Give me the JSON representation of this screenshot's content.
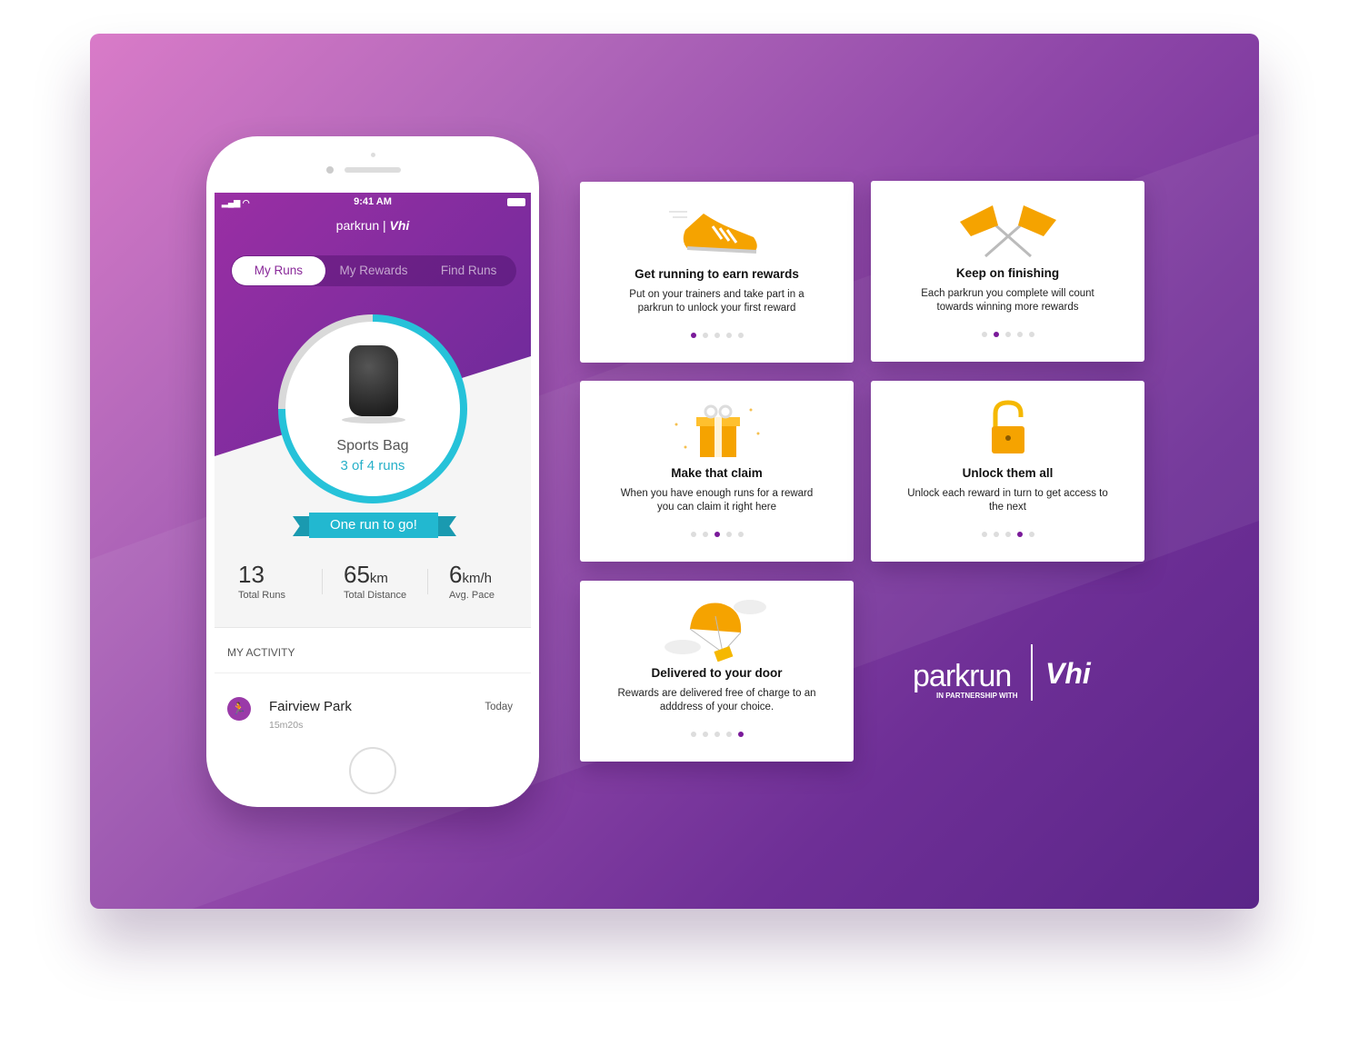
{
  "phone": {
    "status": {
      "time": "9:41 AM"
    },
    "logo": {
      "brand": "parkrun",
      "partner": "Vhi"
    },
    "tabs": [
      {
        "label": "My Runs"
      },
      {
        "label": "My Rewards"
      },
      {
        "label": "Find Runs"
      }
    ],
    "reward": {
      "name": "Sports Bag",
      "progress_text": "3 of 4 runs",
      "progress_fraction": 0.75,
      "banner": "One run to go!"
    },
    "stats": [
      {
        "value": "13",
        "unit": "",
        "label": "Total Runs"
      },
      {
        "value": "65",
        "unit": "km",
        "label": "Total Distance"
      },
      {
        "value": "6",
        "unit": "km/h",
        "label": "Avg. Pace"
      }
    ],
    "activity": {
      "heading": "MY ACTIVITY",
      "items": [
        {
          "name": "Fairview Park",
          "time": "15m20s",
          "date": "Today"
        }
      ]
    }
  },
  "cards": [
    {
      "title": "Get running to earn rewards",
      "text": "Put on your trainers and take part in a parkrun to unlock your first reward",
      "icon": "shoe-icon",
      "active_dot": 0
    },
    {
      "title": "Keep on finishing",
      "text": "Each parkrun you complete will count towards winning more rewards",
      "icon": "flags-icon",
      "active_dot": 1
    },
    {
      "title": "Make that claim",
      "text": "When you have enough runs for a reward you can claim it right here",
      "icon": "gift-icon",
      "active_dot": 2
    },
    {
      "title": "Unlock them all",
      "text": "Unlock each reward in turn to get access to the next",
      "icon": "padlock-icon",
      "active_dot": 3
    },
    {
      "title": "Delivered to your door",
      "text": "Rewards are delivered free of charge to an adddress of your choice.",
      "icon": "parachute-icon",
      "active_dot": 4
    }
  ],
  "logo": {
    "brand": "parkrun",
    "tagline": "IN PARTNERSHIP WITH",
    "partner": "Vhi"
  },
  "colors": {
    "accent": "#8a2a9a",
    "teal": "#26c2d9"
  }
}
